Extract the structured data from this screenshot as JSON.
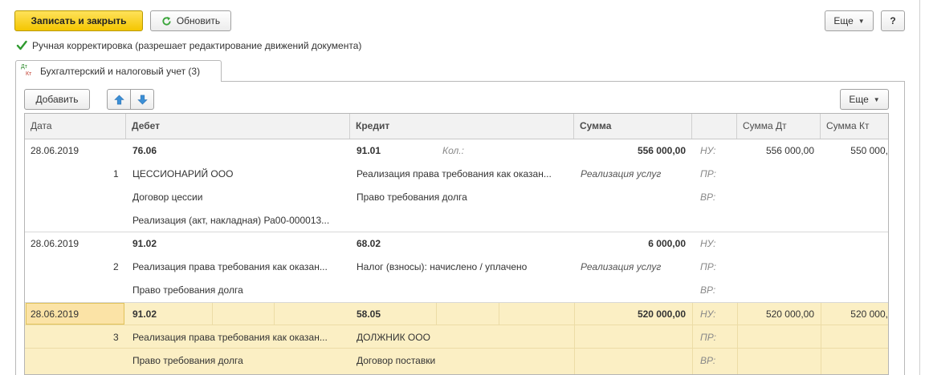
{
  "toolbar": {
    "save_close": "Записать и закрыть",
    "refresh": "Обновить",
    "more": "Еще",
    "help": "?"
  },
  "manual_adjustment": {
    "checked": true,
    "label": "Ручная корректировка (разрешает редактирование движений документа)"
  },
  "tab": {
    "icon_top": "Дт",
    "icon_bottom": "Кт",
    "label": "Бухгалтерский и налоговый учет (3)"
  },
  "grid_toolbar": {
    "add": "Добавить",
    "more": "Еще"
  },
  "columns": {
    "date": "Дата",
    "debit": "Дебет",
    "credit": "Кредит",
    "sum": "Сумма",
    "blank": "",
    "sum_dt": "Сумма Дт",
    "sum_kt": "Сумма Кт"
  },
  "rows": [
    {
      "date": "28.06.2019",
      "num": "1",
      "debit_account": "76.06",
      "debit_sub1": "ЦЕССИОНАРИЙ ООО",
      "debit_sub2": "Договор цессии",
      "debit_sub3": "Реализация (акт, накладная) Ра00-000013...",
      "credit_account": "91.01",
      "qty_label": "Кол.:",
      "credit_sub1": "Реализация права требования как оказан...",
      "credit_sub2": "Право требования долга",
      "sum": "556 000,00",
      "sum_note": "Реализация услуг",
      "nu": "НУ:",
      "pr": "ПР:",
      "vr": "ВР:",
      "sum_dt": "556 000,00",
      "sum_kt": "550 000,"
    },
    {
      "date": "28.06.2019",
      "num": "2",
      "debit_account": "91.02",
      "debit_sub1": "Реализация права требования как оказан...",
      "debit_sub2": "Право требования долга",
      "credit_account": "68.02",
      "credit_sub1": "Налог (взносы): начислено / уплачено",
      "sum": "6 000,00",
      "sum_note": "Реализация услуг",
      "nu": "НУ:",
      "pr": "ПР:",
      "vr": "ВР:"
    },
    {
      "date": "28.06.2019",
      "num": "3",
      "debit_account": "91.02",
      "debit_sub1": "Реализация права требования как оказан...",
      "debit_sub2": "Право требования долга",
      "credit_account": "58.05",
      "credit_sub1": "ДОЛЖНИК ООО",
      "credit_sub2": "Договор поставки",
      "sum": "520 000,00",
      "nu": "НУ:",
      "pr": "ПР:",
      "vr": "ВР:",
      "sum_dt": "520 000,00",
      "sum_kt": "520 000,"
    }
  ],
  "colors": {
    "primary_button": "#f4c600",
    "selected_row": "#fbefc4",
    "refresh_icon": "#3aa53a",
    "arrow_icon": "#3b8fd6"
  }
}
